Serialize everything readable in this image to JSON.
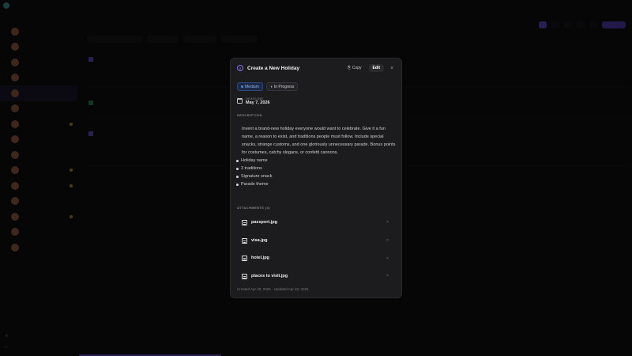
{
  "app": {
    "title": ""
  },
  "sidebar": {
    "items": [
      {
        "label": "",
        "dot": false
      },
      {
        "label": "",
        "dot": false
      },
      {
        "label": "",
        "dot": false
      },
      {
        "label": "",
        "dot": false
      },
      {
        "label": "",
        "dot": false
      },
      {
        "label": "",
        "dot": false
      },
      {
        "label": "",
        "dot": true
      },
      {
        "label": "",
        "dot": false
      },
      {
        "label": "",
        "dot": false
      },
      {
        "label": "",
        "dot": true
      },
      {
        "label": "",
        "dot": true
      },
      {
        "label": "",
        "dot": false
      },
      {
        "label": "",
        "dot": true
      },
      {
        "label": "",
        "dot": false
      },
      {
        "label": "",
        "dot": false
      }
    ]
  },
  "background": {
    "page_title": ""
  },
  "modal": {
    "status_number": "2",
    "title": "Create a New Holiday",
    "copy_label": "Copy",
    "edit_label": "Edit",
    "close_glyph": "×",
    "tags": {
      "priority": "Medium",
      "status": "In Progress"
    },
    "deadline": {
      "label": "DEADLINE",
      "value": "May 7, 2026"
    },
    "description_label": "DESCRIPTION",
    "description": "Invent a brand-new holiday everyone would want to celebrate. Give it a fun name, a reason to exist, and traditions people must follow. Include special snacks, strange customs, and one gloriously unnecessary parade. Bonus points for costumes, catchy slogans, or confetti cannons.",
    "bullets": [
      "Holiday name",
      "3 traditions",
      "Signature snack",
      "Parade theme"
    ],
    "attachments_label": "ATTACHMENTS (4)",
    "attachments": [
      {
        "name": "passport.jpg",
        "size": ""
      },
      {
        "name": "visa.jpg",
        "size": ""
      },
      {
        "name": "hotel.jpg",
        "size": ""
      },
      {
        "name": "places to visit.jpg",
        "size": ""
      }
    ],
    "remove_glyph": "×",
    "meta": "Created Apr 28, 2026 · Updated Apr 28, 2026"
  },
  "colors": {
    "accent": "#6d4fd6",
    "priority": "#4d84e8",
    "background": "#1c1c1f"
  }
}
